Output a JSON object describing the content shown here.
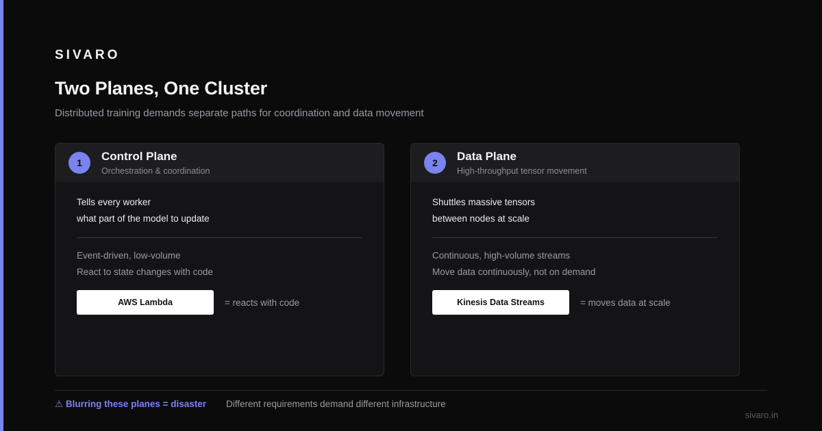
{
  "brand": "SIVARO",
  "title": "Two Planes, One Cluster",
  "subtitle": "Distributed training demands separate paths for coordination and data movement",
  "cards": [
    {
      "number": "1",
      "title": "Control Plane",
      "subtitle": "Orchestration & coordination",
      "line1": "Tells every worker",
      "line2": "what part of the model to update",
      "dim1": "Event-driven, low-volume",
      "dim2": "React to state changes with code",
      "service": "AWS Lambda",
      "service_note": "= reacts with code"
    },
    {
      "number": "2",
      "title": "Data Plane",
      "subtitle": "High-throughput tensor movement",
      "line1": "Shuttles massive tensors",
      "line2": "between nodes at scale",
      "dim1": "Continuous, high-volume streams",
      "dim2": "Move data continuously, not on demand",
      "service": "Kinesis Data Streams",
      "service_note": "= moves data at scale"
    }
  ],
  "footer": {
    "warning": "⚠ Blurring these planes = disaster",
    "note": "Different requirements demand different infrastructure",
    "site": "sivaro.in"
  },
  "colors": {
    "accent": "#7b83f0",
    "background": "#0b0b0c",
    "card": "#141416",
    "card_header": "#1d1d20"
  }
}
